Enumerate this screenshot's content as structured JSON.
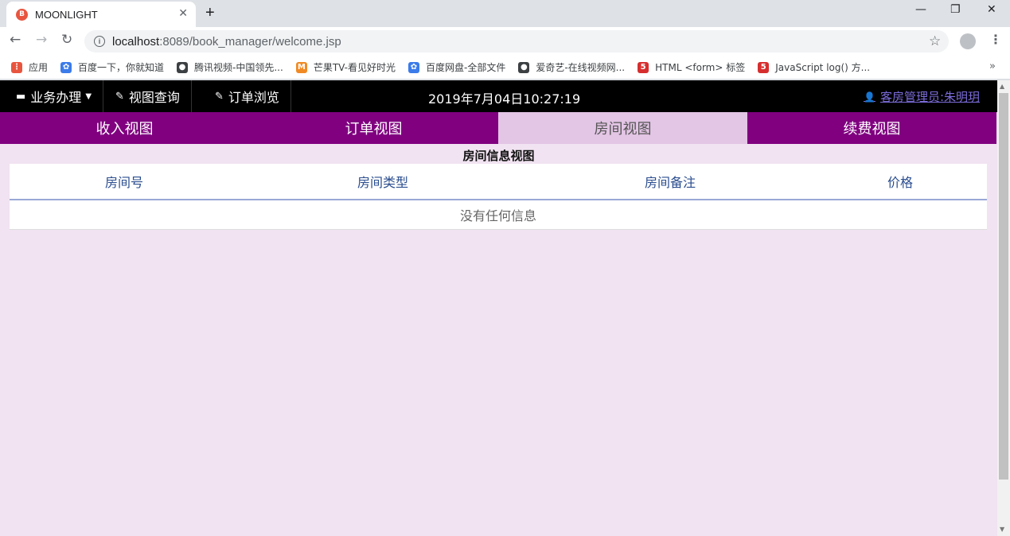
{
  "browser": {
    "tab_title": "MOONLIGHT",
    "new_tab": "+",
    "url_host": "localhost",
    "url_rest": ":8089/book_manager/welcome.jsp",
    "bookmarks": [
      {
        "label": "应用",
        "icon": "apps-grid-icon",
        "color": "#e8553f"
      },
      {
        "label": "百度一下，你就知道",
        "icon": "baidu-paw-icon",
        "color": "#3b7bea"
      },
      {
        "label": "腾讯视频-中国领先...",
        "icon": "globe-icon",
        "color": "#3c4043"
      },
      {
        "label": "芒果TV-看见好时光",
        "icon": "mango-icon",
        "color": "#f08a24"
      },
      {
        "label": "百度网盘-全部文件",
        "icon": "baidu-paw-icon",
        "color": "#3b7bea"
      },
      {
        "label": "爱奇艺-在线视频网...",
        "icon": "globe-icon",
        "color": "#3c4043"
      },
      {
        "label": "HTML <form> 标签",
        "icon": "w3-shield-icon",
        "color": "#d62e2e"
      },
      {
        "label": "JavaScript log() 方...",
        "icon": "w3-shield-icon",
        "color": "#d62e2e"
      }
    ],
    "more": "»"
  },
  "topbar": {
    "business": "业务办理",
    "view_query": "视图查询",
    "order_browse": "订单浏览",
    "clock": "2019年7月04日10:27:19",
    "user": "客房管理员:朱明玥"
  },
  "tabs": [
    "收入视图",
    "订单视图",
    "房间视图",
    "续费视图"
  ],
  "active_tab": 2,
  "section_title": "房间信息视图",
  "table": {
    "columns": [
      "房间号",
      "房间类型",
      "房间备注",
      "价格"
    ],
    "empty_text": "没有任何信息"
  },
  "colors": {
    "tab_bg": "#800080",
    "tab_active_bg": "#e3c5e5",
    "page_bg": "#f1e3f1",
    "header_text": "#2a4d8f"
  }
}
